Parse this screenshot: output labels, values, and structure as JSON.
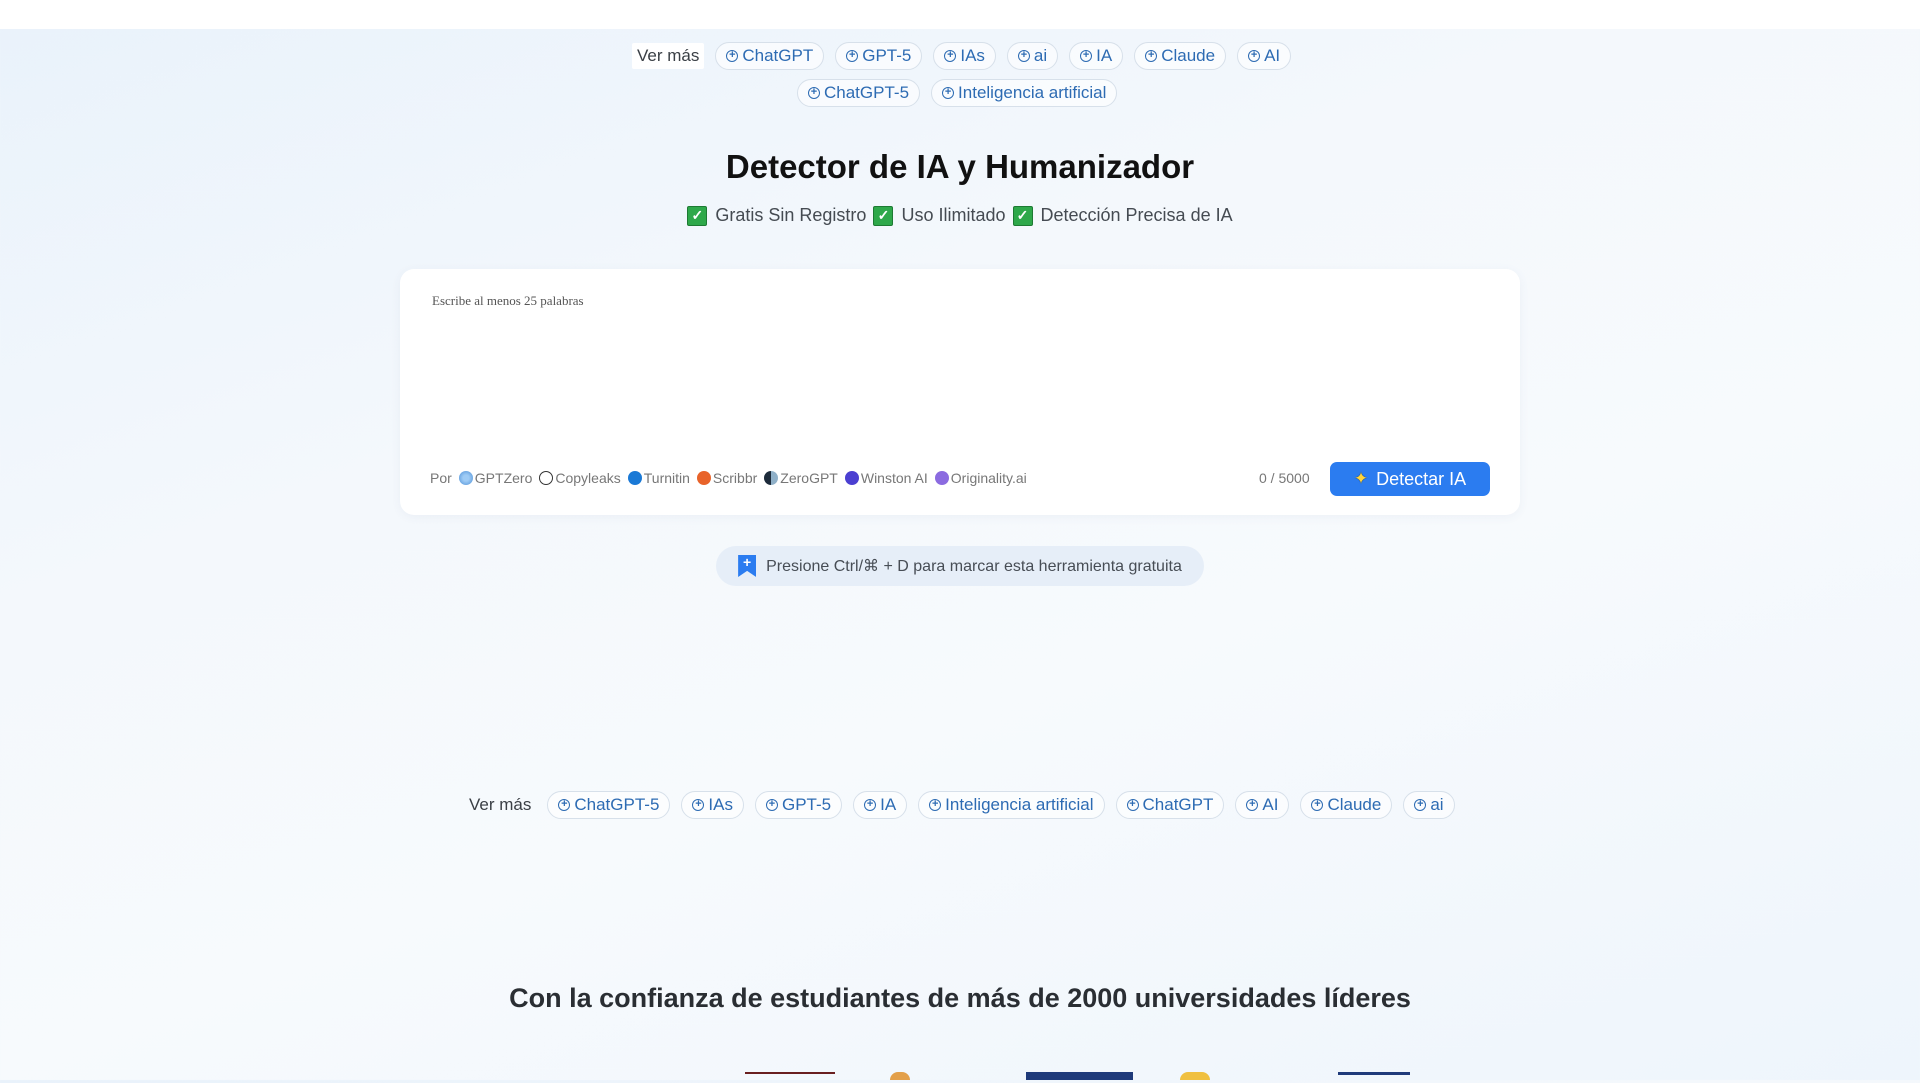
{
  "top_tags": {
    "label": "Ver más",
    "row1": [
      "ChatGPT",
      "GPT-5",
      "IAs",
      "ai",
      "IA",
      "Claude",
      "AI"
    ],
    "row2": [
      "ChatGPT-5",
      "Inteligencia artificial"
    ]
  },
  "hero": {
    "title": "Detector de IA y Humanizador",
    "features": [
      "Gratis Sin Registro",
      "Uso Ilimitado",
      "Detección Precisa de IA"
    ]
  },
  "detector": {
    "placeholder": "Escribe al menos 25 palabras",
    "powered_by_label": "Por",
    "providers": [
      "GPTZero",
      "Copyleaks",
      "Turnitin",
      "Scribbr",
      "ZeroGPT",
      "Winston AI",
      "Originality.ai"
    ],
    "counter": "0 / 5000",
    "button_label": "Detectar IA"
  },
  "bookmark_hint": "Presione Ctrl/⌘ + D para marcar esta herramienta gratuita",
  "bottom_tags": {
    "label": "Ver más",
    "items": [
      "ChatGPT-5",
      "IAs",
      "GPT-5",
      "IA",
      "Inteligencia artificial",
      "ChatGPT",
      "AI",
      "Claude",
      "ai"
    ]
  },
  "trust_heading": "Con la confianza de estudiantes de más de 2000 universidades líderes",
  "colors": {
    "primary": "#2b7cf0",
    "tag_text": "#2d6bb3",
    "check": "#2ea84a"
  }
}
